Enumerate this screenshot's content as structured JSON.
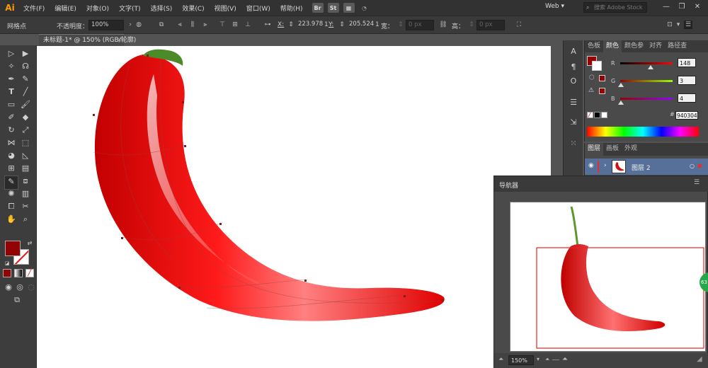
{
  "app": {
    "logo": "Ai"
  },
  "menu": [
    "文件(F)",
    "编辑(E)",
    "对象(O)",
    "文字(T)",
    "选择(S)",
    "效果(C)",
    "视图(V)",
    "窗口(W)",
    "帮助(H)"
  ],
  "menu_buttons": [
    "Br",
    "St"
  ],
  "workspace": "Web",
  "search": {
    "placeholder": "搜索 Adobe Stock"
  },
  "window_controls": {
    "minimize": "—",
    "maximize": "❐",
    "close": "✕"
  },
  "control": {
    "tool_name": "网格点",
    "opacity_label": "不透明度：",
    "opacity_value": "100%",
    "x_label": "X:",
    "x_value": "223.978",
    "x_unit": "1",
    "y_label": "Y:",
    "y_value": "205.524",
    "y_unit": "1",
    "w_label": "宽：",
    "w_value": "0 px",
    "h_label": "高：",
    "h_value": "0 px"
  },
  "document": {
    "tab_title": "未标题-1* @ 150% (RGB/轮廓)",
    "close": "×"
  },
  "color_panel": {
    "tabs": [
      "色板",
      "颜色",
      "颜色参",
      "对齐",
      "路径查"
    ],
    "active_tab": 1,
    "channels": [
      {
        "label": "R",
        "value": "148",
        "fraction": 0.58,
        "gradient": "linear-gradient(to right,#000304,#ff0304)"
      },
      {
        "label": "G",
        "value": "3",
        "fraction": 0.01,
        "gradient": "linear-gradient(to right,#940004,#94ff04)"
      },
      {
        "label": "B",
        "value": "4",
        "fraction": 0.02,
        "gradient": "linear-gradient(to right,#940300,#9403ff)"
      }
    ],
    "hex_symbol": "#",
    "hex": "940304",
    "fill_color": "#940304"
  },
  "layers_panel": {
    "tabs": [
      "图层",
      "画板",
      "外观"
    ],
    "layer_name": "图层 2"
  },
  "navigator": {
    "title": "导航器",
    "zoom": "150%",
    "badge": "63"
  }
}
